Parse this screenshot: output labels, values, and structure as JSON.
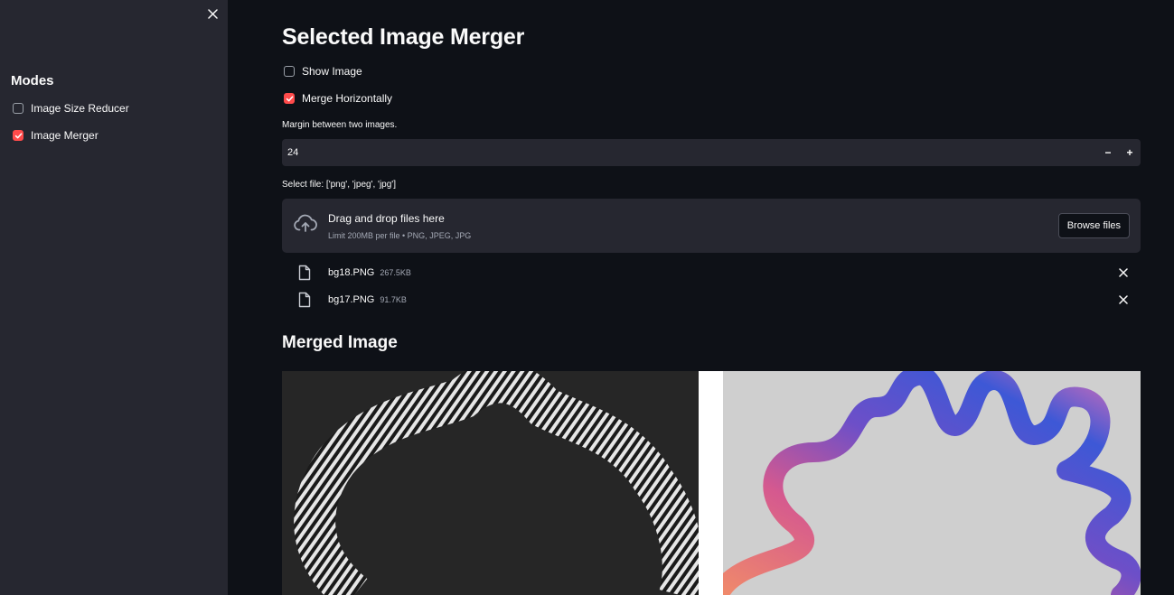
{
  "sidebar": {
    "title": "Modes",
    "items": [
      {
        "label": "Image Size Reducer",
        "checked": false
      },
      {
        "label": "Image Merger",
        "checked": true
      }
    ]
  },
  "main": {
    "title": "Selected Image Merger",
    "show_image": {
      "label": "Show Image",
      "checked": false
    },
    "merge_horizontally": {
      "label": "Merge Horizontally",
      "checked": true
    },
    "margin": {
      "label": "Margin between two images.",
      "value": "24",
      "decrement": "−",
      "increment": "+"
    },
    "uploader": {
      "label": "Select file: ['png', 'jpeg', 'jpg']",
      "drop_title": "Drag and drop files here",
      "drop_sub": "Limit 200MB per file • PNG, JPEG, JPG",
      "browse_label": "Browse files"
    },
    "files": [
      {
        "name": "bg18.PNG",
        "size": "267.5KB"
      },
      {
        "name": "bg17.PNG",
        "size": "91.7KB"
      }
    ],
    "merged_title": "Merged Image"
  },
  "colors": {
    "accent": "#ff4b4b",
    "background": "#0e1117",
    "sidebar": "#262730"
  }
}
